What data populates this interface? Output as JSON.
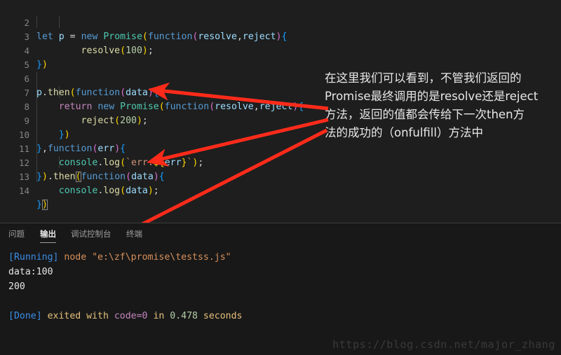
{
  "editor": {
    "first_line_number": 2,
    "lines": [
      {
        "n": 2,
        "text": "let p = new Promise(function(resolve,reject){"
      },
      {
        "n": 3,
        "text": "        resolve(100);"
      },
      {
        "n": 4,
        "text": "})"
      },
      {
        "n": 5,
        "text": ""
      },
      {
        "n": 6,
        "text": "p.then(function(data){"
      },
      {
        "n": 7,
        "text": "    return new Promise(function(resolve,reject){"
      },
      {
        "n": 8,
        "text": "        reject(200);"
      },
      {
        "n": 9,
        "text": "    })"
      },
      {
        "n": 10,
        "text": "},function(err){"
      },
      {
        "n": 11,
        "text": "    console.log(`err:${err}`);"
      },
      {
        "n": 12,
        "text": "}).then(function(data){"
      },
      {
        "n": 13,
        "text": "    console.log(data);"
      },
      {
        "n": 14,
        "text": "})"
      }
    ]
  },
  "annotation": {
    "line1": "在这里我们可以看到，不管我们返回的",
    "line2": "Promise最终调用的是resolve还是reject",
    "line3": "方法，返回的值都会传给下一次then方",
    "line4": "法的成功的（onfulfill）方法中",
    "arrow_color": "#ff2b1a"
  },
  "panel": {
    "tabs": [
      {
        "label": "问题",
        "active": false
      },
      {
        "label": "输出",
        "active": true
      },
      {
        "label": "调试控制台",
        "active": false
      },
      {
        "label": "终端",
        "active": false
      }
    ],
    "output": {
      "running_tag": "[Running]",
      "running_cmd": " node ",
      "running_path": "\"e:\\zf\\promise\\testss.js\"",
      "line_data": "data:100",
      "line_value": "200",
      "done_tag": "[Done]",
      "done_mid": " exited with ",
      "done_code": "code=0",
      "done_in": " in ",
      "done_time": "0.478",
      "done_unit": " seconds"
    }
  },
  "watermark": {
    "text": "https://blog.csdn.net/major_zhang"
  },
  "colors": {
    "editor_bg": "#1e1e1e",
    "panel_bg": "#181818",
    "gutter_fg": "#858585",
    "accent_red": "#ff2b1a"
  }
}
